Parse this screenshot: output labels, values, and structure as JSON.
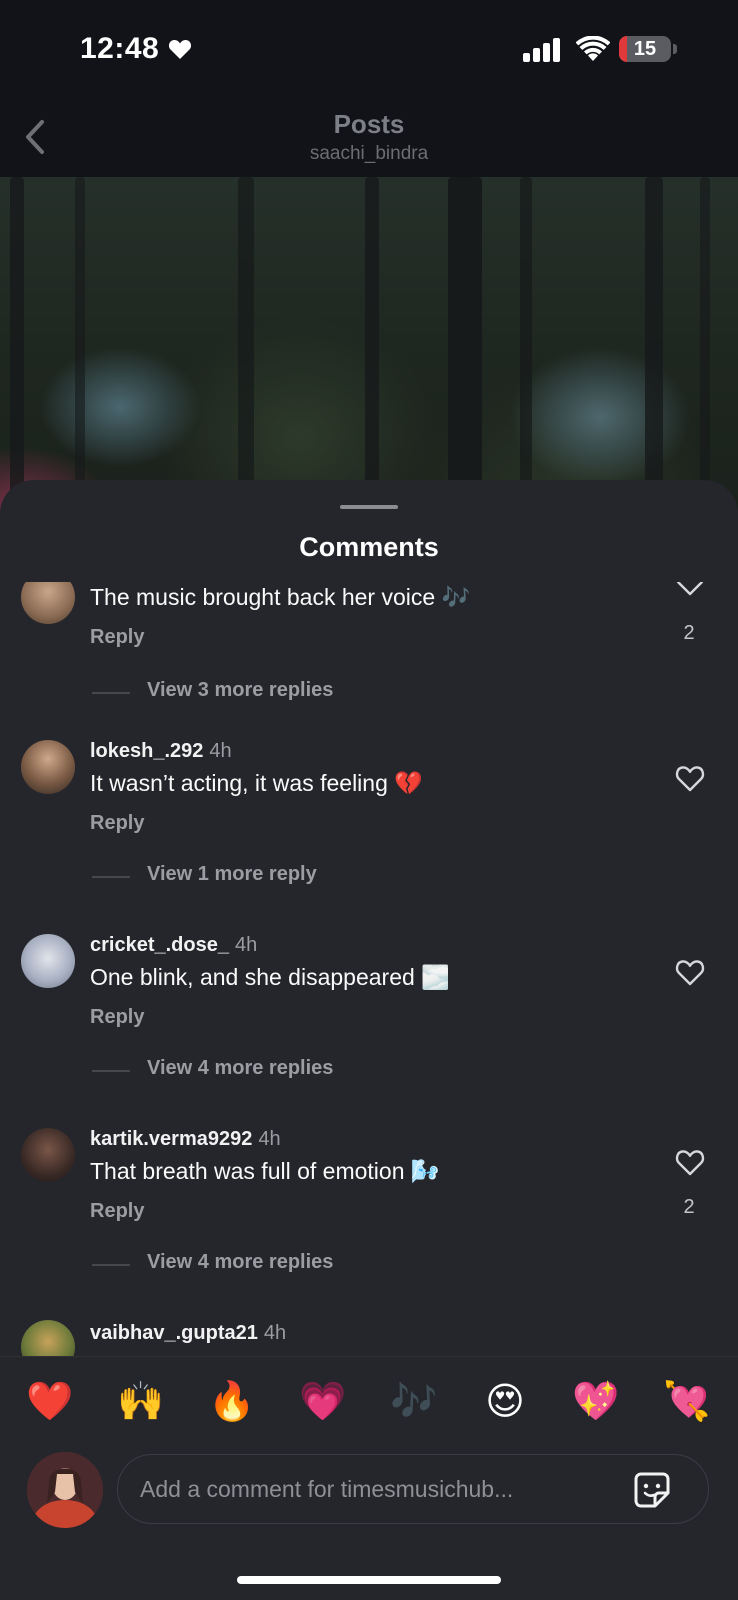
{
  "status_bar": {
    "time": "12:48",
    "battery_level": "15",
    "battery_fraction": 0.15,
    "icons": [
      "heart-icon",
      "cellular-signal-icon",
      "wifi-icon",
      "battery-icon"
    ]
  },
  "header": {
    "title": "Posts",
    "subtitle": "saachi_bindra",
    "back_icon": "chevron-left-icon"
  },
  "comments_sheet": {
    "title": "Comments",
    "comments": [
      {
        "username": "",
        "time": "",
        "text": "The music brought back her voice 🎶",
        "reply_label": "Reply",
        "like_count": "2",
        "view_replies": "View 3 more replies"
      },
      {
        "username": "lokesh_.292",
        "time": "4h",
        "text": "It wasn’t acting, it was feeling 💔",
        "reply_label": "Reply",
        "like_count": "",
        "view_replies": "View 1 more reply"
      },
      {
        "username": "cricket_.dose_",
        "time": "4h",
        "text": "One blink, and she disappeared 🌫️",
        "reply_label": "Reply",
        "like_count": "",
        "view_replies": "View 4 more replies"
      },
      {
        "username": "kartik.verma9292",
        "time": "4h",
        "text": "That breath was full of emotion 🌬️",
        "reply_label": "Reply",
        "like_count": "2",
        "view_replies": "View 4 more replies"
      },
      {
        "username": "vaibhav_.gupta21",
        "time": "4h",
        "text": "",
        "reply_label": "",
        "like_count": "",
        "view_replies": ""
      }
    ]
  },
  "emoji_bar": {
    "emojis": [
      "❤️",
      "🙌",
      "🔥",
      "💗",
      "🎶",
      "😍",
      "💖",
      "💘"
    ]
  },
  "composer": {
    "placeholder": "Add a comment for timesmusichub...",
    "sticker_icon": "sticker-icon"
  },
  "colors": {
    "sheet_background": "#25262c",
    "battery_low": "#e0393c",
    "secondary_text": "#9b9da3"
  }
}
